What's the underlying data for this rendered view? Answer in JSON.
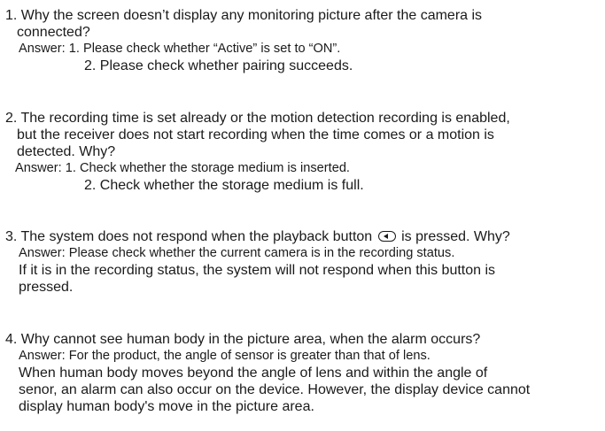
{
  "faq": [
    {
      "question_lines": [
        "1. Why the screen doesn’t display any monitoring picture after the camera is",
        "connected?"
      ],
      "answer_1": "Answer: 1. Please check whether “Active” is set to “ON”.",
      "answer_2": "2. Please check whether pairing succeeds."
    },
    {
      "question_lines": [
        "2. The recording time is set already or the motion detection recording is enabled,",
        "but the receiver does not start recording when the time comes or a motion is",
        "detected. Why?"
      ],
      "answer_1": "Answer: 1. Check whether the storage medium is inserted.",
      "answer_2": "2. Check whether the storage medium is full."
    },
    {
      "question_before_icon": "3. The system does not respond when the playback button",
      "icon": "playback-button-icon",
      "question_after_icon": "is pressed. Why?",
      "answer_1": "Answer: Please check whether the current camera is in the recording  status.",
      "answer_lines": [
        "If it is in the recording status, the system will not respond when this button is",
        "pressed."
      ]
    },
    {
      "question": "4. Why cannot see human body in the picture area, when the alarm occurs?",
      "answer_1": "Answer: For the product, the angle of sensor is greater than that of lens.",
      "answer_lines": [
        "When human body moves beyond the angle of lens and within the angle of",
        "senor, an alarm can also occur on the device. However, the display device cannot",
        "display human body's move in the picture area."
      ]
    }
  ]
}
